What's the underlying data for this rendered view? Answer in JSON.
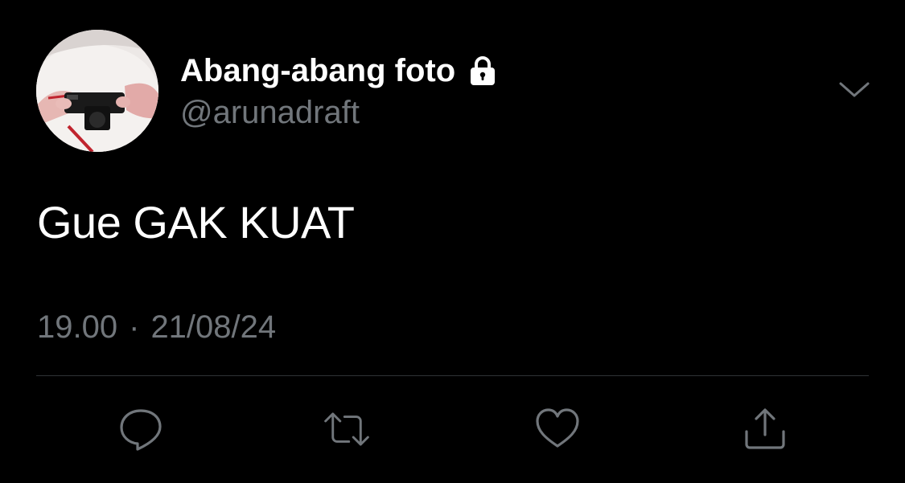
{
  "tweet": {
    "author": {
      "display_name": "Abang-abang foto",
      "handle": "@arunadraft",
      "protected_icon": "lock-icon",
      "avatar": "camera-photo-avatar"
    },
    "text": "Gue GAK KUAT",
    "time": "19.00",
    "separator": "·",
    "date": "21/08/24"
  },
  "actions": [
    {
      "name": "reply",
      "icon": "reply-icon"
    },
    {
      "name": "retweet",
      "icon": "retweet-icon"
    },
    {
      "name": "like",
      "icon": "heart-icon"
    },
    {
      "name": "share",
      "icon": "share-icon"
    }
  ],
  "more_menu": {
    "icon": "chevron-down-icon"
  },
  "colors": {
    "background": "#000000",
    "primary_text": "#ffffff",
    "secondary_text": "#71767b",
    "divider": "#2f3336"
  }
}
